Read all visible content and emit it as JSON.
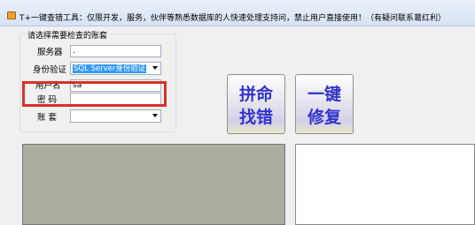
{
  "window": {
    "title": "T+一键查错工具：仅限开发，服务，伙伴等熟悉数据库的人快速处理支持问，禁止用户直接使用！（有疑问联系葛红利）"
  },
  "group": {
    "legend": "请选择需要检查的账套",
    "server_label": "服务器",
    "server_value": ".",
    "auth_label": "身份验证",
    "auth_value": "SQL Server身份验证",
    "user_label": "用户名",
    "user_value": "sa",
    "password_label": "密  码",
    "password_value": "",
    "account_label": "账  套",
    "account_value": ""
  },
  "buttons": {
    "find_errors_line1": "拼命",
    "find_errors_line2": "找错",
    "fix_line1": "一键",
    "fix_line2": "修复"
  },
  "colors": {
    "highlight_border": "#d8312a",
    "button_text": "#3333cc",
    "selection": "#3399ff",
    "left_panel": "#adad9f"
  },
  "icons": {
    "app": "app-icon",
    "dropdown": "chevron-down-icon"
  }
}
